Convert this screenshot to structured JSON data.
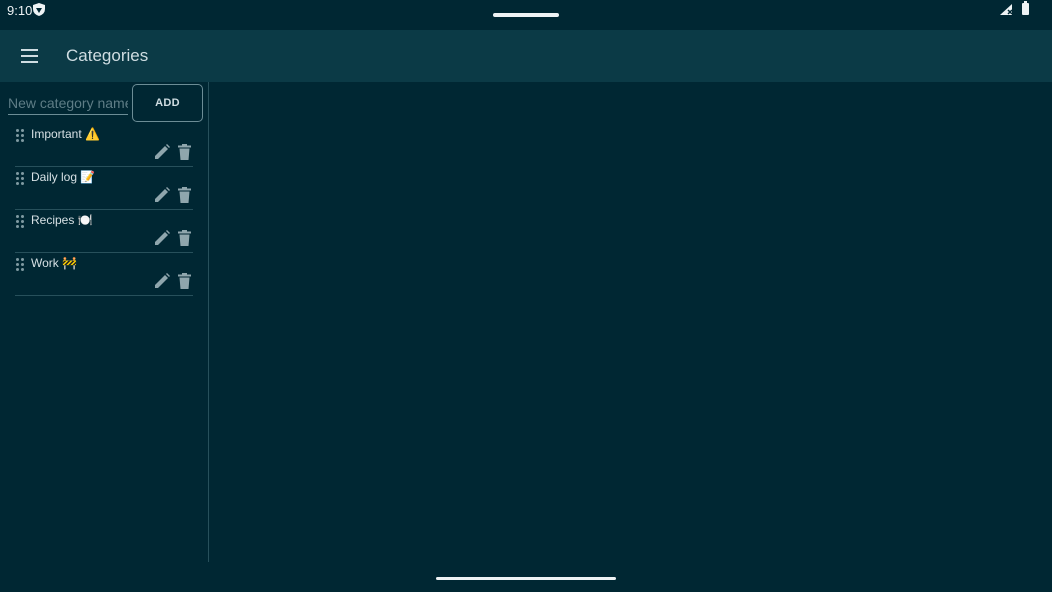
{
  "status_bar": {
    "time": "9:10",
    "icons": [
      "vpn-key-icon",
      "signal-icon",
      "battery-icon"
    ]
  },
  "app_bar": {
    "title": "Categories",
    "menu_icon": "hamburger-menu-icon"
  },
  "new_category": {
    "placeholder": "New category name",
    "value": "",
    "add_label": "ADD"
  },
  "categories": [
    {
      "label": "Important ⚠️"
    },
    {
      "label": "Daily log 📝"
    },
    {
      "label": "Recipes 🍽️"
    },
    {
      "label": "Work 🚧"
    }
  ],
  "colors": {
    "background": "#002733",
    "app_bar": "#0b3a46",
    "text": "#d6e0e4",
    "icon": "#8fa6ad"
  }
}
